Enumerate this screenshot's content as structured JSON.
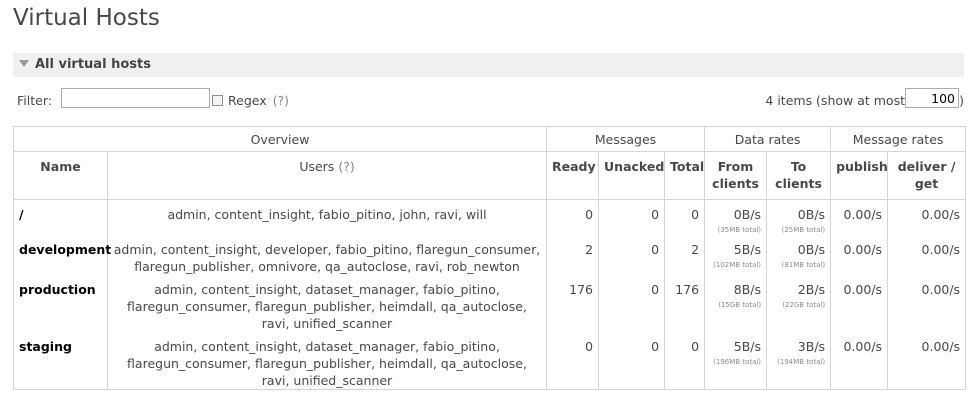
{
  "page": {
    "title": "Virtual Hosts"
  },
  "section": {
    "title": "All virtual hosts"
  },
  "filter": {
    "label": "Filter:",
    "value": "",
    "regex_label": "Regex",
    "regex_help": "(?)",
    "items_text": "4 items (show at most",
    "page_size": "100",
    "items_close": ")"
  },
  "table": {
    "groups": {
      "overview": "Overview",
      "messages": "Messages",
      "data_rates": "Data rates",
      "message_rates": "Message rates"
    },
    "columns": {
      "name": "Name",
      "users": "Users",
      "users_help": "(?)",
      "ready": "Ready",
      "unacked": "Unacked",
      "total": "Total",
      "from_clients": "From clients",
      "to_clients": "To clients",
      "publish": "publish",
      "deliver_get": "deliver / get"
    },
    "rows": [
      {
        "name": "/",
        "users": "admin, content_insight, fabio_pitino, john, ravi, will",
        "ready": "0",
        "unacked": "0",
        "total": "0",
        "from_rate": "0B/s",
        "from_total": "(35MB total)",
        "to_rate": "0B/s",
        "to_total": "(25MB total)",
        "publish": "0.00/s",
        "deliver": "0.00/s"
      },
      {
        "name": "development",
        "users": "admin, content_insight, developer, fabio_pitino, flaregun_consumer, flaregun_publisher, omnivore, qa_autoclose, ravi, rob_newton",
        "ready": "2",
        "unacked": "0",
        "total": "2",
        "from_rate": "5B/s",
        "from_total": "(102MB total)",
        "to_rate": "0B/s",
        "to_total": "(81MB total)",
        "publish": "0.00/s",
        "deliver": "0.00/s"
      },
      {
        "name": "production",
        "users": "admin, content_insight, dataset_manager, fabio_pitino, flaregun_consumer, flaregun_publisher, heimdall, qa_autoclose, ravi, unified_scanner",
        "ready": "176",
        "unacked": "0",
        "total": "176",
        "from_rate": "8B/s",
        "from_total": "(15GB total)",
        "to_rate": "2B/s",
        "to_total": "(22GB total)",
        "publish": "0.00/s",
        "deliver": "0.00/s"
      },
      {
        "name": "staging",
        "users": "admin, content_insight, dataset_manager, fabio_pitino, flaregun_consumer, flaregun_publisher, heimdall, qa_autoclose, ravi, unified_scanner",
        "ready": "0",
        "unacked": "0",
        "total": "0",
        "from_rate": "5B/s",
        "from_total": "(196MB total)",
        "to_rate": "3B/s",
        "to_total": "(194MB total)",
        "publish": "0.00/s",
        "deliver": "0.00/s"
      }
    ]
  }
}
